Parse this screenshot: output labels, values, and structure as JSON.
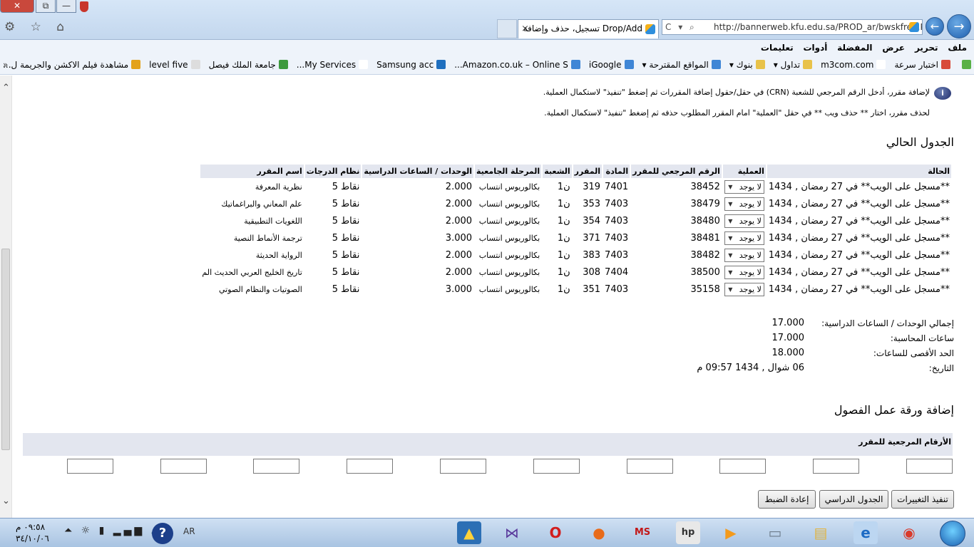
{
  "browser": {
    "tab_title": "تسجيل، حذف وإضافة Drop/Add",
    "tab_close": "×",
    "address_url": "http://bannerweb.kfu.edu.sa/PROD_ar/bwskfreg.P_",
    "address_icons": "C ▾ ⌕",
    "back": "←",
    "forward": "→",
    "window_controls": {
      "close": "✕",
      "restore": "⧉",
      "minimize": "—"
    },
    "tools_icons": "⚙ ☆ ⌂"
  },
  "menu": [
    "ملف",
    "تحرير",
    "عرض",
    "المفضلة",
    "أدوات",
    "تعليمات"
  ],
  "favorites": {
    "chevron": "»",
    "items": [
      {
        "label": "",
        "color": "#59b046"
      },
      {
        "label": "اختبار سرعة",
        "color": "#d84b3a"
      },
      {
        "label": "m3com.com",
        "color": "#ffffff"
      },
      {
        "label": "تداول ▾",
        "color": "#e8c24a"
      },
      {
        "label": "بنوك ▾",
        "color": "#e8c24a"
      },
      {
        "label": "المواقع المقترحة ▾",
        "color": "#3f86d6"
      },
      {
        "label": "iGoogle",
        "color": "#3f86d6"
      },
      {
        "label": "Amazon.co.uk – Online S...",
        "color": "#3f86d6"
      },
      {
        "label": "Samsung acc",
        "color": "#1f6fbf"
      },
      {
        "label": "My Services...",
        "color": "#ffffff"
      },
      {
        "label": "جامعة الملك فيصل",
        "color": "#3d9a3d"
      },
      {
        "label": "level five",
        "color": "#dddddd"
      },
      {
        "label": "مشاهدة فيلم الاكشن والجريمة ل...",
        "color": "#e3a21a"
      }
    ]
  },
  "info": {
    "icon": "i",
    "line1": "لإضافة مقرر، أدخل الرقم المرجعي للشعبة (CRN) في حقل/حقول إضافة المقررات ثم إضغط \"تنفيذ\" لاستكمال العملية.",
    "line2": "لحذف مقرر، اختار ** حذف ويب ** في حقل \"العملية\" امام المقرر المطلوب حذفه ثم إضغط \"تنفيذ\" لاستكمال العملية."
  },
  "schedule": {
    "title": "الجدول الحالي",
    "headers": [
      "الحالة",
      "العملية",
      "الرقم المرجعي للمقرر",
      "المادة",
      "المقرر",
      "الشعبة",
      "المرحلة الجامعية",
      "الوحدات / الساعات الدراسية",
      "نظام الدرجات",
      "اسم المقرر"
    ],
    "rows": [
      {
        "status": "**مسجل على الويب** في 27 رمضان , 1434",
        "action": "لا يوجد",
        "crn": "38452",
        "subject": "7401",
        "course": "319",
        "section": "ن1",
        "level": "بكالوريوس انتساب",
        "units": "2.000",
        "grade": "نقاط 5",
        "name": "نظرية المعرفة"
      },
      {
        "status": "**مسجل على الويب** في 27 رمضان , 1434",
        "action": "لا يوجد",
        "crn": "38479",
        "subject": "7403",
        "course": "353",
        "section": "ن1",
        "level": "بكالوريوس انتساب",
        "units": "2.000",
        "grade": "نقاط 5",
        "name": "علم المعاني والبراغماتيك"
      },
      {
        "status": "**مسجل على الويب** في 27 رمضان , 1434",
        "action": "لا يوجد",
        "crn": "38480",
        "subject": "7403",
        "course": "354",
        "section": "ن1",
        "level": "بكالوريوس انتساب",
        "units": "2.000",
        "grade": "نقاط 5",
        "name": "اللغويات التطبيقية"
      },
      {
        "status": "**مسجل على الويب** في 27 رمضان , 1434",
        "action": "لا يوجد",
        "crn": "38481",
        "subject": "7403",
        "course": "371",
        "section": "ن1",
        "level": "بكالوريوس انتساب",
        "units": "3.000",
        "grade": "نقاط 5",
        "name": "ترجمة الأنماط النصية"
      },
      {
        "status": "**مسجل على الويب** في 27 رمضان , 1434",
        "action": "لا يوجد",
        "crn": "38482",
        "subject": "7403",
        "course": "383",
        "section": "ن1",
        "level": "بكالوريوس انتساب",
        "units": "2.000",
        "grade": "نقاط 5",
        "name": "الرواية الحديثة"
      },
      {
        "status": "**مسجل على الويب** في 27 رمضان , 1434",
        "action": "لا يوجد",
        "crn": "38500",
        "subject": "7404",
        "course": "308",
        "section": "ن1",
        "level": "بكالوريوس انتساب",
        "units": "2.000",
        "grade": "نقاط 5",
        "name": "تاريخ الخليج العربي الحديث الم"
      },
      {
        "status": "**مسجل على الويب** في 27 رمضان , 1434",
        "action": "لا يوجد",
        "crn": "35158",
        "subject": "7403",
        "course": "351",
        "section": "ن1",
        "level": "بكالوريوس انتساب",
        "units": "3.000",
        "grade": "نقاط 5",
        "name": "الصوتيات والنظام الصوتي"
      }
    ]
  },
  "totals": {
    "units_label": "إجمالي الوحدات / الساعات الدراسية:",
    "units_value": "17.000",
    "billing_label": "ساعات المحاسبة:",
    "billing_value": "17.000",
    "max_label": "الحد الأقصى للساعات:",
    "max_value": "18.000",
    "date_label": "التاريخ:",
    "date_value": "06 شوال , 1434 09:57 م"
  },
  "add": {
    "title": "إضافة ورقة عمل الفصول",
    "header": "الأرقام المرجعية للمقرر",
    "boxes": 10
  },
  "buttons": {
    "submit": "تنفيذ التغييرات",
    "schedule": "الجدول الدراسي",
    "reset": "إعادة الضبط"
  },
  "taskbar": {
    "time": "٠٩:٥٨ م",
    "date": "٣٤/١٠/٠٦",
    "lang": "AR",
    "help": "?",
    "tray_icons": "⏶ ☼ ▮ ▂▄▆ 🔊"
  }
}
